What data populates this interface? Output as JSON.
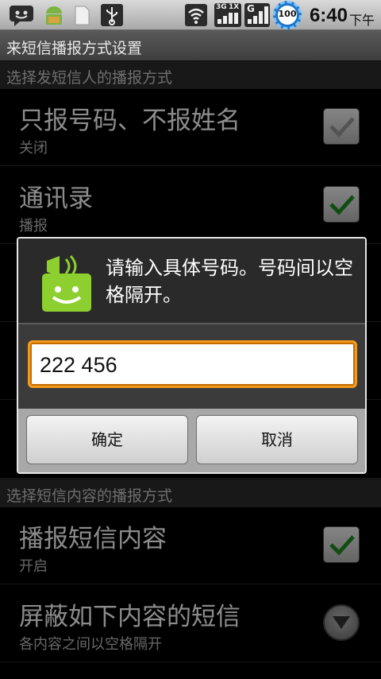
{
  "status_bar": {
    "time": "6:40",
    "ampm": "下午",
    "battery_level": "100",
    "network_3g": "3G",
    "network_1x": "1X",
    "network_g": "G",
    "icons": [
      "sms-notification-icon",
      "android-icon",
      "sd-card-icon",
      "usb-icon",
      "wifi-icon",
      "signal-3g-icon",
      "signal-g-icon",
      "battery-icon"
    ]
  },
  "title_bar": {
    "title": "来短信播报方式设置"
  },
  "sections": [
    {
      "header": "选择发短信人的播报方式"
    },
    {
      "header": "选择短信内容的播报方式"
    }
  ],
  "prefs": [
    {
      "title": "只报号码、不报姓名",
      "summary": "关闭",
      "checked": false
    },
    {
      "title": "通讯录",
      "summary": "播报",
      "checked": true
    },
    {
      "title": "播报短信内容",
      "summary": "开启",
      "checked": true
    },
    {
      "title": "屏蔽如下内容的短信",
      "summary": "各内容之间以空格隔开"
    }
  ],
  "dialog": {
    "title": "请输入具体号码。号码间以空格隔开。",
    "input_value": "222 456",
    "ok_label": "确定",
    "cancel_label": "取消",
    "icon": "sms-speaker-icon"
  },
  "colors": {
    "accent": "#f39a1d",
    "check_green": "#1f8c22"
  }
}
